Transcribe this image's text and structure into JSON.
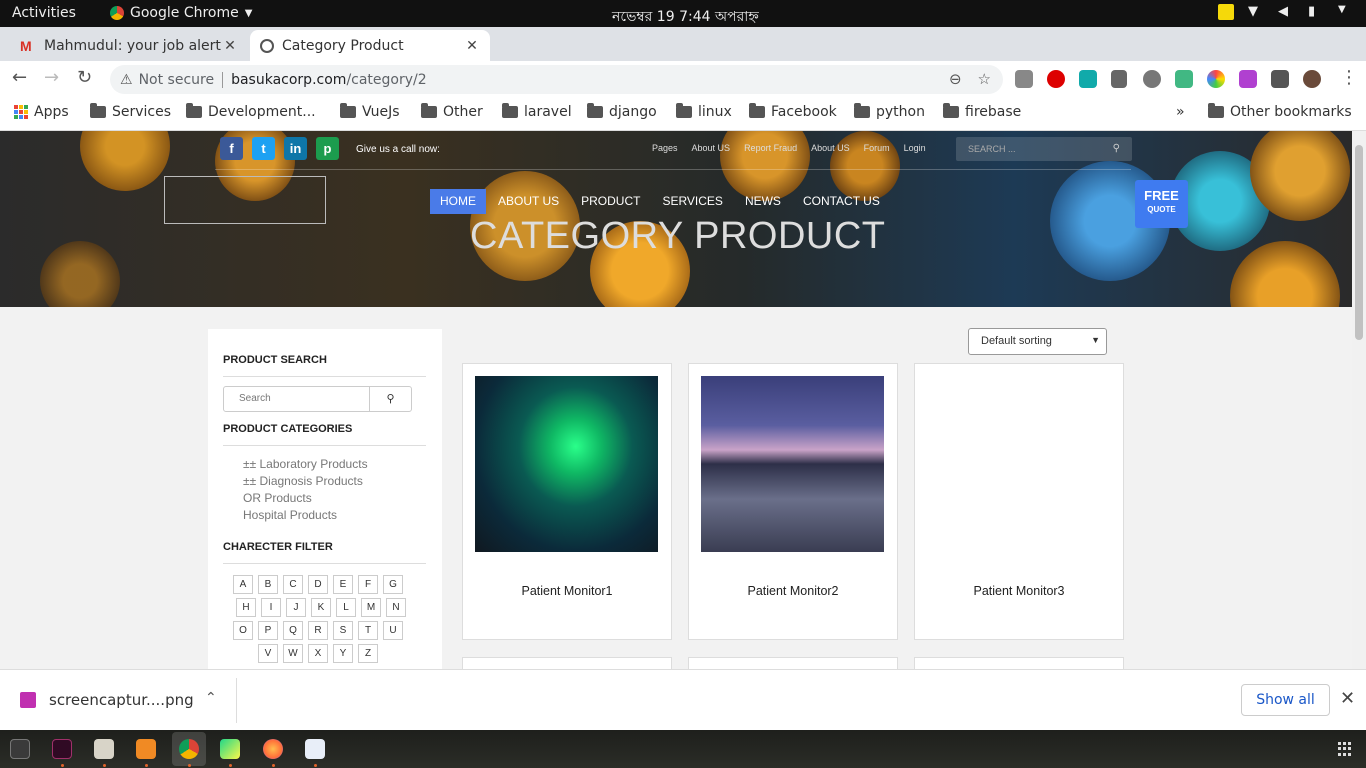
{
  "system_bar": {
    "activities": "Activities",
    "app_name": "Google Chrome",
    "clock": "নভেম্বর 19   7:44 অপরাহ্ন"
  },
  "tabs": [
    {
      "label": "Mahmudul: your job alert",
      "icon": "gmail-icon"
    },
    {
      "label": "Category Product",
      "icon": "globe-icon"
    }
  ],
  "toolbar": {
    "not_secure": "Not secure",
    "url_host": "basukacorp.com",
    "url_path": "/category/2"
  },
  "bookmarks": {
    "apps": "Apps",
    "items": [
      "Services",
      "Development...",
      "VueJs",
      "Other",
      "laravel",
      "django",
      "linux",
      "Facebook",
      "python",
      "firebase"
    ],
    "more": "»",
    "other": "Other bookmarks"
  },
  "site": {
    "call_text": "Give us a call now:",
    "top_links": [
      "Pages",
      "About US",
      "Report Fraud",
      "About US",
      "Forum",
      "Login"
    ],
    "search_placeholder": "SEARCH ...",
    "nav": [
      "HOME",
      "ABOUT US",
      "PRODUCT",
      "SERVICES",
      "NEWS",
      "CONTACT US"
    ],
    "free_quote": {
      "line1": "FREE",
      "line2": "QUOTE"
    },
    "page_title": "CATEGORY PRODUCT",
    "social": [
      "facebook-icon",
      "twitter-icon",
      "linkedin-icon",
      "pinterest-icon"
    ]
  },
  "sidebar": {
    "search_heading": "PRODUCT SEARCH",
    "search_placeholder": "Search",
    "categories_heading": "PRODUCT CATEGORIES",
    "categories": [
      "±± Laboratory Products",
      "±± Diagnosis Products",
      "OR Products",
      "Hospital Products"
    ],
    "filter_heading": "CHARECTER FILTER",
    "letters": [
      [
        "A",
        "B",
        "C",
        "D",
        "E",
        "F",
        "G"
      ],
      [
        "H",
        "I",
        "J",
        "K",
        "L",
        "M",
        "N"
      ],
      [
        "O",
        "P",
        "Q",
        "R",
        "S",
        "T",
        "U"
      ],
      [
        "V",
        "W",
        "X",
        "Y",
        "Z"
      ]
    ]
  },
  "sorting": {
    "selected": "Default sorting"
  },
  "products": [
    {
      "name": "Patient Monitor1"
    },
    {
      "name": "Patient Monitor2"
    },
    {
      "name": "Patient Monitor3"
    }
  ],
  "download": {
    "filename": "screencaptur....png",
    "show_all": "Show all"
  },
  "colors": {
    "nav_active": "#4a7be8",
    "free_quote": "#3f7bf0",
    "show_all_text": "#1a57c8"
  }
}
